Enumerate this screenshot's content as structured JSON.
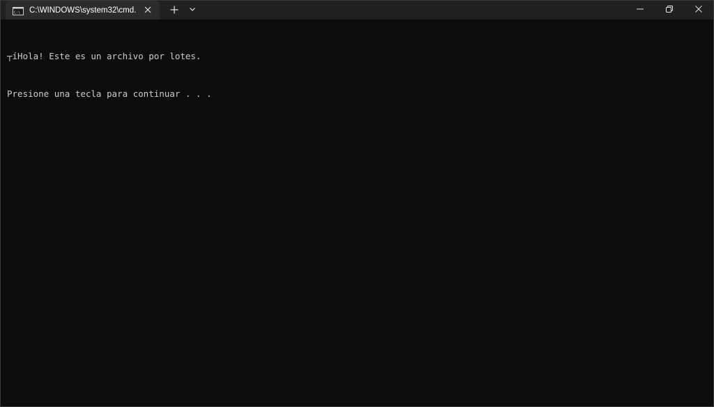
{
  "tab": {
    "title": "C:\\WINDOWS\\system32\\cmd."
  },
  "icons": {
    "tab_icon": "cmd-terminal-icon",
    "tab_close": "close-icon",
    "new_tab": "plus-icon",
    "dropdown": "chevron-down-icon",
    "minimize": "minimize-icon",
    "restore": "restore-icon",
    "close": "close-icon"
  },
  "console": {
    "lines": [
      "┬íHola! Este es un archivo por lotes.",
      "Presione una tecla para continuar . . ."
    ]
  },
  "colors": {
    "background": "#0c0c0c",
    "titlebar": "#202020",
    "active_tab": "#2b2b2b",
    "text": "#cccccc"
  }
}
